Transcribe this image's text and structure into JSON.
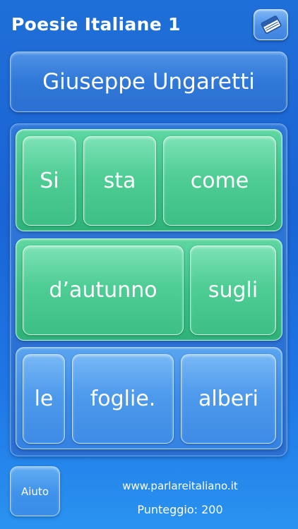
{
  "header": {
    "title": "Poesie Italiane 1",
    "menu_icon": "book-icon"
  },
  "author": {
    "name": "Giuseppe Ungaretti"
  },
  "puzzle": {
    "rows": [
      {
        "state": "solved",
        "color": "#3cbf86",
        "words": [
          "Si",
          "sta",
          "come"
        ]
      },
      {
        "state": "solved",
        "color": "#3cbf86",
        "words": [
          "d’autunno",
          "sugli"
        ]
      },
      {
        "state": "unsolved",
        "color": "#3d8be6",
        "words": [
          "le",
          "foglie.",
          "alberi"
        ]
      }
    ]
  },
  "footer": {
    "help_label": "Aiuto",
    "website": "www.parlareitaliano.it",
    "score_label": "Punteggio: 200"
  }
}
